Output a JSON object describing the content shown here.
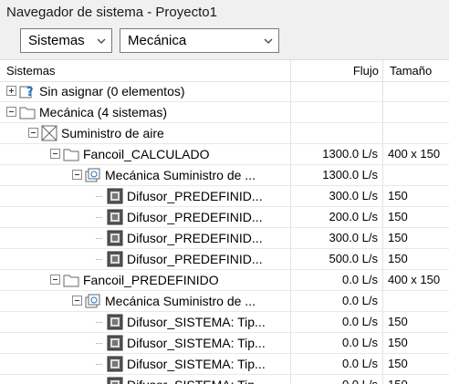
{
  "window": {
    "title": "Navegador de sistema - Proyecto1"
  },
  "toolbar": {
    "filter1": "Sistemas",
    "filter2": "Mecánica"
  },
  "columns": {
    "name": "Sistemas",
    "flow": "Flujo",
    "size": "Tamaño"
  },
  "rows": [
    {
      "name": "Sin asignar (0 elementos)",
      "flow": "",
      "size": "",
      "icon": "unassigned-icon"
    },
    {
      "name": "Mecánica (4 sistemas)",
      "flow": "",
      "size": "",
      "icon": "folder-icon"
    },
    {
      "name": "Suministro de aire",
      "flow": "",
      "size": "",
      "icon": "supply-air-icon"
    },
    {
      "name": "Fancoil_CALCULADO",
      "flow": "1300.0 L/s",
      "size": "400 x 150",
      "icon": "folder-icon"
    },
    {
      "name": "Mecánica Suministro de ...",
      "flow": "1300.0 L/s",
      "size": "",
      "icon": "duct-system-icon"
    },
    {
      "name": "Difusor_PREDEFINID...",
      "flow": "300.0 L/s",
      "size": "150",
      "icon": "diffuser-icon"
    },
    {
      "name": "Difusor_PREDEFINID...",
      "flow": "200.0 L/s",
      "size": "150",
      "icon": "diffuser-icon"
    },
    {
      "name": "Difusor_PREDEFINID...",
      "flow": "300.0 L/s",
      "size": "150",
      "icon": "diffuser-icon"
    },
    {
      "name": "Difusor_PREDEFINID...",
      "flow": "500.0 L/s",
      "size": "150",
      "icon": "diffuser-icon"
    },
    {
      "name": "Fancoil_PREDEFINIDO",
      "flow": "0.0 L/s",
      "size": "400 x 150",
      "icon": "folder-icon"
    },
    {
      "name": "Mecánica Suministro de ...",
      "flow": "0.0 L/s",
      "size": "",
      "icon": "duct-system-icon"
    },
    {
      "name": "Difusor_SISTEMA: Tip...",
      "flow": "0.0 L/s",
      "size": "150",
      "icon": "diffuser-icon"
    },
    {
      "name": "Difusor_SISTEMA: Tip...",
      "flow": "0.0 L/s",
      "size": "150",
      "icon": "diffuser-icon"
    },
    {
      "name": "Difusor_SISTEMA: Tip...",
      "flow": "0.0 L/s",
      "size": "150",
      "icon": "diffuser-icon"
    },
    {
      "name": "Difusor_SISTEMA: Tip...",
      "flow": "0.0 L/s",
      "size": "150",
      "icon": "diffuser-icon"
    }
  ]
}
